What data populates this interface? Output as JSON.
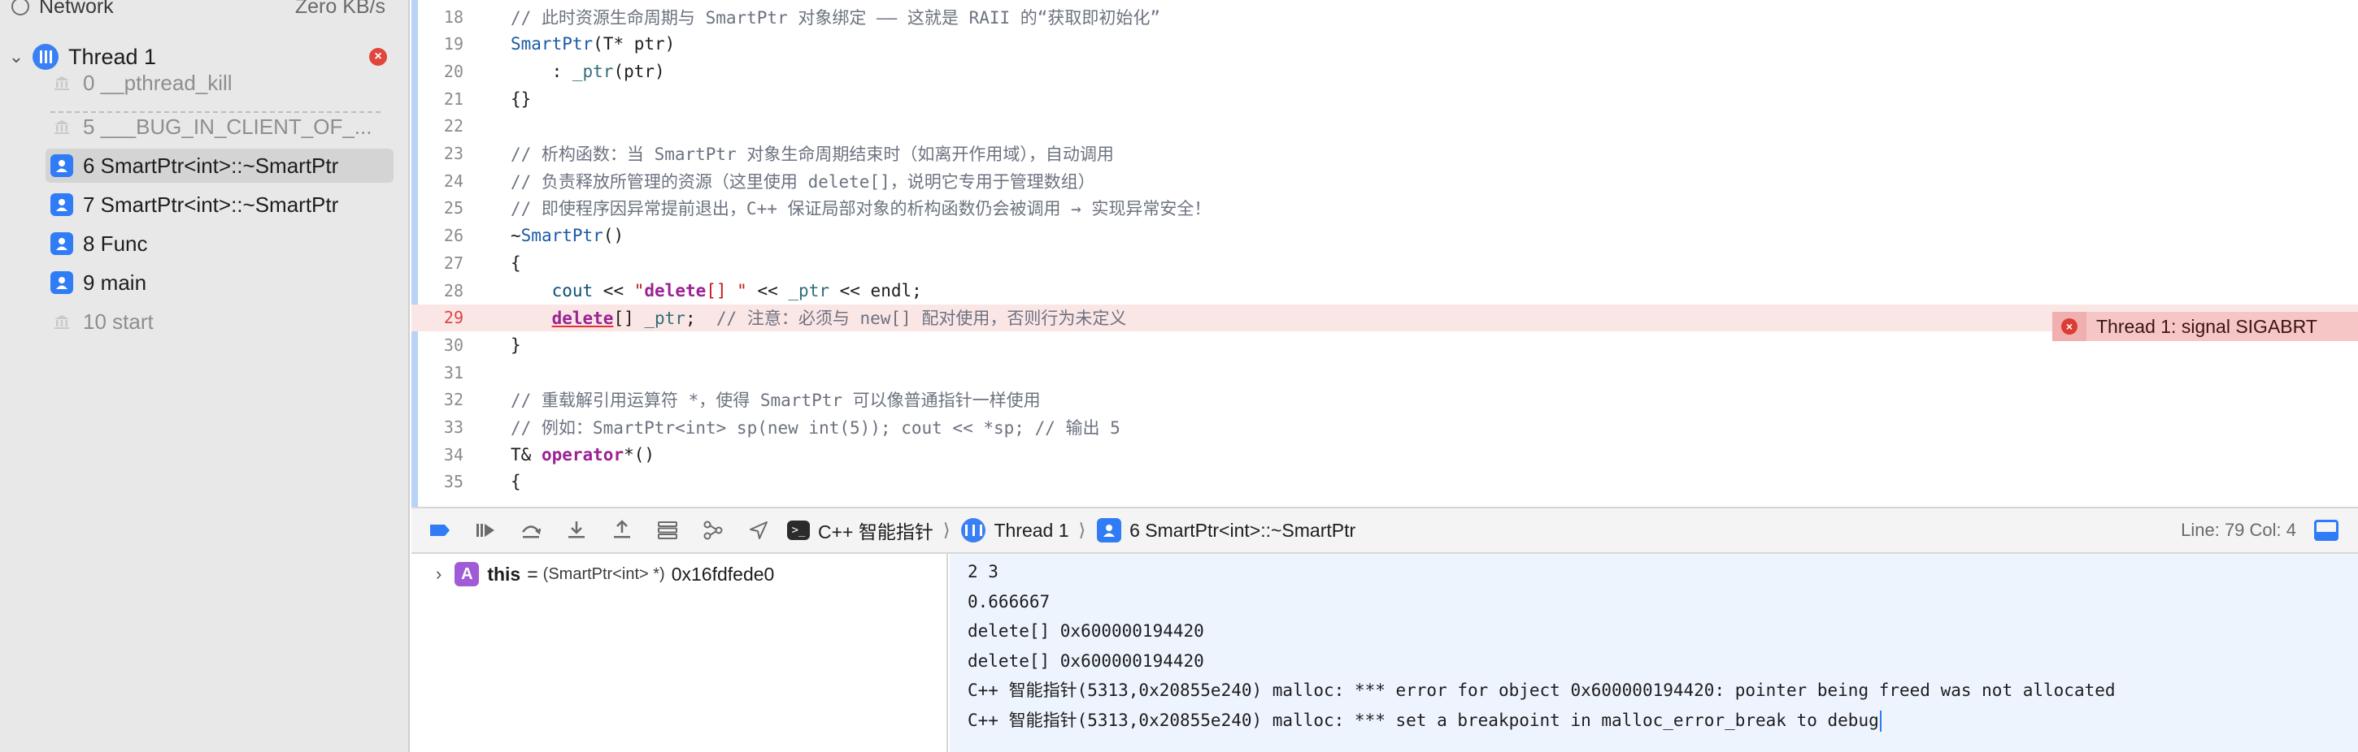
{
  "navigator": {
    "network_label": "Network",
    "network_speed": "Zero KB/s",
    "thread": {
      "label": "Thread 1",
      "error_badge": "×"
    },
    "frames": [
      {
        "label": "0 __pthread_kill",
        "kind": "system"
      },
      {
        "label": "5 ___BUG_IN_CLIENT_OF_...",
        "kind": "system"
      },
      {
        "label": "6 SmartPtr<int>::~SmartPtr",
        "kind": "user",
        "selected": true
      },
      {
        "label": "7 SmartPtr<int>::~SmartPtr",
        "kind": "user"
      },
      {
        "label": "8 Func",
        "kind": "user"
      },
      {
        "label": "9 main",
        "kind": "user"
      },
      {
        "label": "10 start",
        "kind": "system"
      }
    ]
  },
  "editor": {
    "lines": [
      {
        "num": "18",
        "text": "// 此时资源生命周期与 SmartPtr 对象绑定 —— 这就是 RAII 的“获取即初始化”"
      },
      {
        "num": "19",
        "text": "SmartPtr(T* ptr)"
      },
      {
        "num": "20",
        "text": "    : _ptr(ptr)"
      },
      {
        "num": "21",
        "text": "{}"
      },
      {
        "num": "22",
        "text": ""
      },
      {
        "num": "23",
        "text": "// 析构函数：当 SmartPtr 对象生命周期结束时（如离开作用域），自动调用"
      },
      {
        "num": "24",
        "text": "// 负责释放所管理的资源（这里使用 delete[]，说明它专用于管理数组）"
      },
      {
        "num": "25",
        "text": "// 即使程序因异常提前退出，C++ 保证局部对象的析构函数仍会被调用 → 实现异常安全！"
      },
      {
        "num": "26",
        "text": "~SmartPtr()"
      },
      {
        "num": "27",
        "text": "{"
      },
      {
        "num": "28",
        "text": "    cout << \"delete[] \" << _ptr << endl;"
      },
      {
        "num": "29",
        "text": "    delete[] _ptr;  // 注意：必须与 new[] 配对使用，否则行为未定义"
      },
      {
        "num": "30",
        "text": "}"
      },
      {
        "num": "31",
        "text": ""
      },
      {
        "num": "32",
        "text": "// 重载解引用运算符 *，使得 SmartPtr 可以像普通指针一样使用"
      },
      {
        "num": "33",
        "text": "// 例如：SmartPtr<int> sp(new int(5)); cout << *sp; // 输出 5"
      },
      {
        "num": "34",
        "text": "T& operator*()"
      },
      {
        "num": "35",
        "text": "{"
      }
    ],
    "error_annotation": "Thread 1: signal SIGABRT"
  },
  "debug_bar": {
    "breadcrumbs": [
      "C++ 智能指针",
      "Thread 1",
      "6 SmartPtr<int>::~SmartPtr"
    ],
    "position": "Line: 79  Col: 4"
  },
  "variables": {
    "name": "this",
    "badge": "A",
    "equals": "=",
    "type": "(SmartPtr<int> *)",
    "value": "0x16fdfede0"
  },
  "console": {
    "lines": [
      "2 3",
      "0.666667",
      "delete[] 0x600000194420",
      "delete[] 0x600000194420",
      "C++ 智能指针(5313,0x20855e240) malloc: *** error for object 0x600000194420: pointer being freed was not allocated",
      "C++ 智能指针(5313,0x20855e240) malloc: *** set a breakpoint in malloc_error_break to debug"
    ]
  },
  "colors": {
    "accent": "#2f7cf6",
    "error": "#dd3b35",
    "error_line_bg": "#fbe6e6",
    "console_bg": "#eef4fd"
  }
}
